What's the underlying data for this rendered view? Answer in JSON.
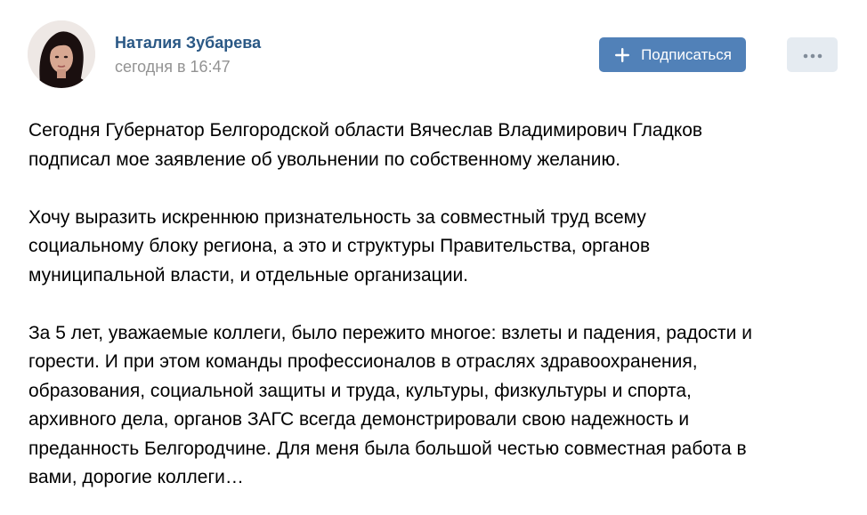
{
  "author": {
    "name": "Наталия Зубарева",
    "date": "сегодня в 16:47"
  },
  "actions": {
    "subscribe_label": "Подписаться",
    "subscribe_icon": "plus-icon",
    "more_icon": "more-dots-icon"
  },
  "post": {
    "paragraphs": [
      "Сегодня Губернатор Белгородской области Вячеслав Владимирович Гладков\nподписал мое заявление об увольнении по собственному желанию.",
      "Хочу выразить искреннюю признательность за совместный труд всему\nсоциальному блоку региона, а это и структуры Правительства, органов\nмуниципальной власти, и отдельные организации.",
      "За 5 лет, уважаемые коллеги, было пережито многое: взлеты и падения, радости и\nгорести. И при этом команды профессионалов в отраслях здравоохранения,\nобразования, социальной защиты и труда, культуры, физкультуры и спорта,\nархивного дела, органов ЗАГС всегда демонстрировали свою надежность и\nпреданность Белгородчине. Для меня была большой честью совместная работа в\nвами, дорогие коллеги…"
    ]
  },
  "colors": {
    "author_link": "#2a5885",
    "date_gray": "#939393",
    "button_primary": "#5181b8",
    "button_secondary": "#e5ebf1",
    "more_dots": "#818c99"
  }
}
